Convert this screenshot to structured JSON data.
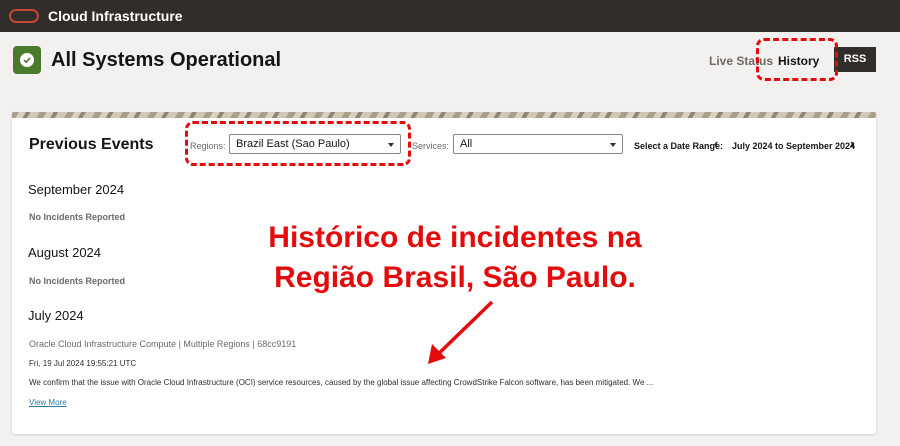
{
  "header": {
    "brand": "Cloud Infrastructure"
  },
  "status": {
    "title": "All Systems Operational",
    "nav": {
      "live_status": "Live Status",
      "history": "History",
      "rss": "RSS"
    }
  },
  "filters": {
    "title": "Previous Events",
    "regions_label": "Regions:",
    "region_value": "Brazil East (Sao Paulo)",
    "services_label": "Services:",
    "service_value": "All",
    "date_label": "Select a Date Range:",
    "date_range": "July 2024 to September 2024"
  },
  "months": [
    {
      "name": "September 2024",
      "note": "No Incidents Reported"
    },
    {
      "name": "August 2024",
      "note": "No Incidents Reported"
    },
    {
      "name": "July 2024",
      "event": {
        "title": "Oracle Cloud Infrastructure Compute | Multiple Regions | 68cc9191",
        "time": "Fri, 19 Jul 2024 19:55:21 UTC",
        "description": "We confirm that the issue with Oracle Cloud Infrastructure (OCI) service resources, caused by the global issue affecting CrowdStrike Falcon software, has been mitigated. We ...",
        "link": "View More"
      }
    }
  ],
  "annotation": {
    "line1": "Histórico de incidentes na",
    "line2": "Região Brasil, São Paulo."
  },
  "colors": {
    "annotation": "#e30b0b",
    "header_bg": "#312d2a",
    "success": "#4b7a2f"
  },
  "icons": {
    "logo": "oracle-logo-icon",
    "status": "check-circle-icon",
    "select": "caret-down-icon",
    "prev": "chevron-left-icon",
    "next": "chevron-right-icon"
  }
}
